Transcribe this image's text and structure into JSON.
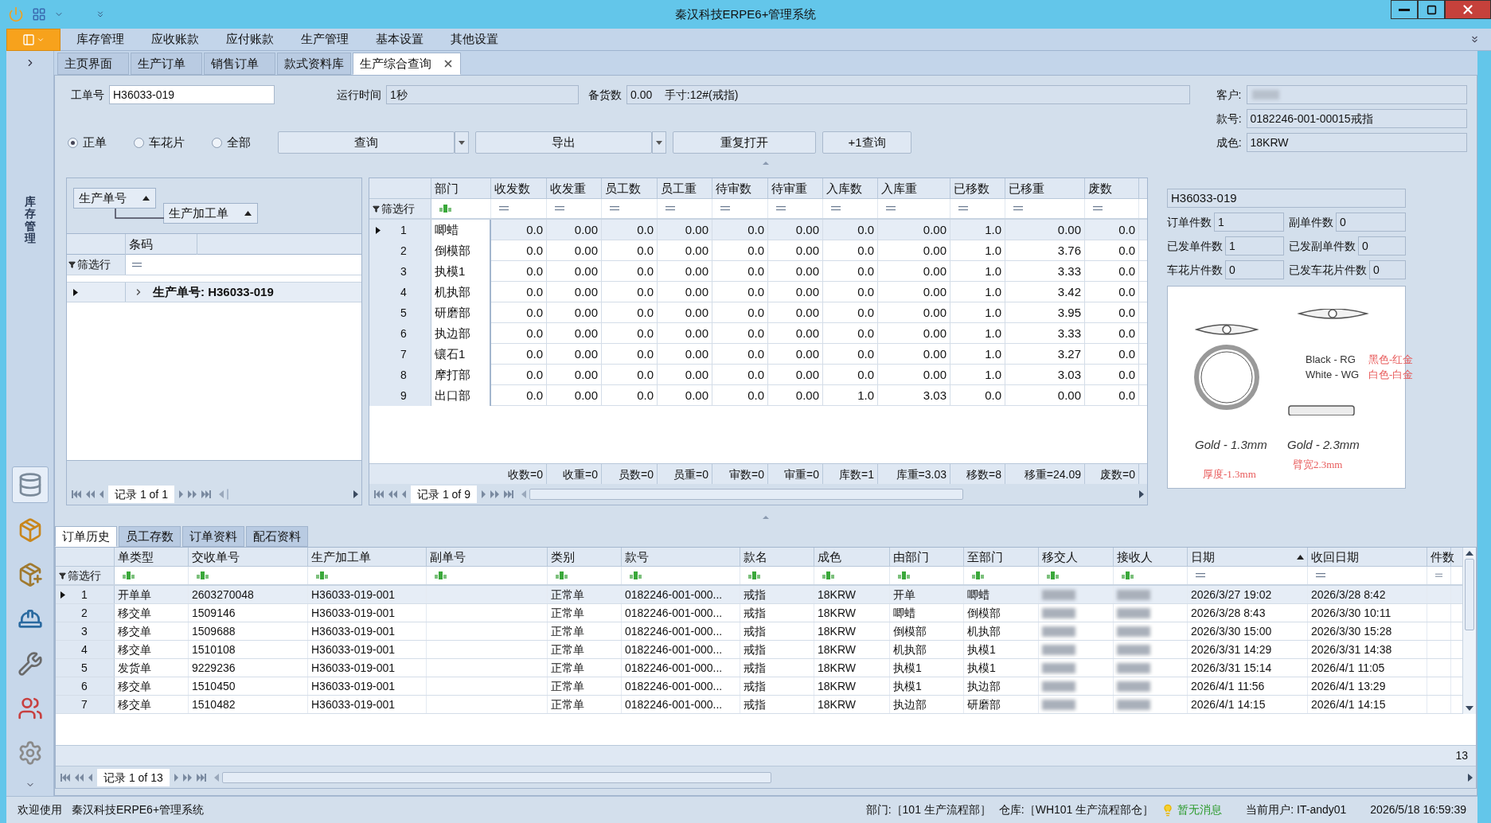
{
  "window": {
    "title": "秦汉科技ERPE6+管理系统"
  },
  "menu": [
    "库存管理",
    "应收账款",
    "应付账款",
    "生产管理",
    "基本设置",
    "其他设置"
  ],
  "sidebar": {
    "title": "库存管理"
  },
  "tabs": [
    {
      "label": "主页界面",
      "selected": false,
      "closable": false
    },
    {
      "label": "生产订单",
      "selected": false,
      "closable": false
    },
    {
      "label": "销售订单",
      "selected": false,
      "closable": false
    },
    {
      "label": "款式资料库",
      "selected": false,
      "closable": false
    },
    {
      "label": "生产综合查询",
      "selected": true,
      "closable": true
    }
  ],
  "form": {
    "work_order": {
      "label": "工单号",
      "value": "H36033-019"
    },
    "run_time": {
      "label": "运行时间",
      "value": "1秒"
    },
    "stock": {
      "label": "备货数",
      "value": "0.00    手寸:12#(戒指)"
    },
    "customer": {
      "label": "客户:",
      "masked": true
    },
    "style_no": {
      "label": "款号:",
      "value": "0182246-001-00015戒指"
    },
    "color": {
      "label": "成色:",
      "value": "18KRW"
    }
  },
  "radios": [
    {
      "label": "正单",
      "selected": true
    },
    {
      "label": "车花片",
      "selected": false
    },
    {
      "label": "全部",
      "selected": false
    }
  ],
  "buttons": [
    {
      "label": "查询",
      "dropdown": true
    },
    {
      "label": "导出",
      "dropdown": true
    },
    {
      "label": "重复打开",
      "dropdown": false
    },
    {
      "label": "+1查询",
      "dropdown": false
    }
  ],
  "group_panel": {
    "groups": [
      "生产单号",
      "生产加工单"
    ],
    "columns": [
      "条码"
    ],
    "filter_label": "筛选行",
    "group_row": "生产单号: H36033-019",
    "pager": "记录 1 of 1"
  },
  "dept_grid": {
    "columns": [
      {
        "label": "部门",
        "kind": "text"
      },
      {
        "label": "收发数",
        "kind": "number"
      },
      {
        "label": "收发重",
        "kind": "number"
      },
      {
        "label": "员工数",
        "kind": "number"
      },
      {
        "label": "员工重",
        "kind": "number"
      },
      {
        "label": "待审数",
        "kind": "number"
      },
      {
        "label": "待审重",
        "kind": "number"
      },
      {
        "label": "入库数",
        "kind": "number"
      },
      {
        "label": "入库重",
        "kind": "number"
      },
      {
        "label": "已移数",
        "kind": "number"
      },
      {
        "label": "已移重",
        "kind": "number"
      },
      {
        "label": "废数",
        "kind": "number"
      }
    ],
    "filter_label": "筛选行",
    "rows": [
      {
        "num": "1",
        "selected": true,
        "cells": [
          "唧蜡",
          "0.0",
          "0.00",
          "0.0",
          "0.00",
          "0.0",
          "0.00",
          "0.0",
          "0.00",
          "1.0",
          "0.00",
          "0.0"
        ]
      },
      {
        "num": "2",
        "selected": false,
        "cells": [
          "倒模部",
          "0.0",
          "0.00",
          "0.0",
          "0.00",
          "0.0",
          "0.00",
          "0.0",
          "0.00",
          "1.0",
          "3.76",
          "0.0"
        ]
      },
      {
        "num": "3",
        "selected": false,
        "cells": [
          "执模1",
          "0.0",
          "0.00",
          "0.0",
          "0.00",
          "0.0",
          "0.00",
          "0.0",
          "0.00",
          "1.0",
          "3.33",
          "0.0"
        ]
      },
      {
        "num": "4",
        "selected": false,
        "cells": [
          "机执部",
          "0.0",
          "0.00",
          "0.0",
          "0.00",
          "0.0",
          "0.00",
          "0.0",
          "0.00",
          "1.0",
          "3.42",
          "0.0"
        ]
      },
      {
        "num": "5",
        "selected": false,
        "cells": [
          "研磨部",
          "0.0",
          "0.00",
          "0.0",
          "0.00",
          "0.0",
          "0.00",
          "0.0",
          "0.00",
          "1.0",
          "3.95",
          "0.0"
        ]
      },
      {
        "num": "6",
        "selected": false,
        "cells": [
          "执边部",
          "0.0",
          "0.00",
          "0.0",
          "0.00",
          "0.0",
          "0.00",
          "0.0",
          "0.00",
          "1.0",
          "3.33",
          "0.0"
        ]
      },
      {
        "num": "7",
        "selected": false,
        "cells": [
          "镶石1",
          "0.0",
          "0.00",
          "0.0",
          "0.00",
          "0.0",
          "0.00",
          "0.0",
          "0.00",
          "1.0",
          "3.27",
          "0.0"
        ]
      },
      {
        "num": "8",
        "selected": false,
        "cells": [
          "摩打部",
          "0.0",
          "0.00",
          "0.0",
          "0.00",
          "0.0",
          "0.00",
          "0.0",
          "0.00",
          "1.0",
          "3.03",
          "0.0"
        ]
      },
      {
        "num": "9",
        "selected": false,
        "cells": [
          "出口部",
          "0.0",
          "0.00",
          "0.0",
          "0.00",
          "0.0",
          "0.00",
          "1.0",
          "3.03",
          "0.0",
          "0.00",
          "0.0"
        ]
      }
    ],
    "totals": [
      "收数=0",
      "收重=0",
      "员数=0",
      "员重=0",
      "审数=0",
      "审重=0",
      "库数=1",
      "库重=3.03",
      "移数=8",
      "移重=24.09",
      "废数=0"
    ],
    "pager": "记录 1 of 9"
  },
  "detail": {
    "header": "H36033-019",
    "fields": [
      {
        "label": "订单件数",
        "value": "1"
      },
      {
        "label": "副单件数",
        "value": "0"
      },
      {
        "label": "已发单件数",
        "value": "1"
      },
      {
        "label": "已发副单件数",
        "value": "0"
      },
      {
        "label": "车花片件数",
        "value": "0"
      },
      {
        "label": "已发车花片件数",
        "value": "0"
      }
    ],
    "image_labels": [
      {
        "text": "Black -  RG",
        "color": "#333333"
      },
      {
        "text": "White - WG",
        "color": "#333333"
      },
      {
        "text": "黑色-红金",
        "color": "#e85a5a"
      },
      {
        "text": "白色-白金",
        "color": "#e85a5a"
      },
      {
        "text": "Gold - 1.3mm",
        "color": "#333333"
      },
      {
        "text": "Gold - 2.3mm",
        "color": "#333333"
      },
      {
        "text": "厚度-1.3mm",
        "color": "#e85a5a"
      },
      {
        "text": "臂宽2.3mm",
        "color": "#e85a5a"
      }
    ]
  },
  "bottom_tabs": [
    {
      "label": "订单历史",
      "selected": true
    },
    {
      "label": "员工存数",
      "selected": false
    },
    {
      "label": "订单资料",
      "selected": false
    },
    {
      "label": "配石资料",
      "selected": false
    }
  ],
  "history_grid": {
    "columns": [
      {
        "label": "单类型",
        "kind": "text"
      },
      {
        "label": "交收单号",
        "kind": "text"
      },
      {
        "label": "生产加工单",
        "kind": "text"
      },
      {
        "label": "副单号",
        "kind": "text"
      },
      {
        "label": "类别",
        "kind": "text"
      },
      {
        "label": "款号",
        "kind": "text"
      },
      {
        "label": "款名",
        "kind": "text"
      },
      {
        "label": "成色",
        "kind": "text"
      },
      {
        "label": "由部门",
        "kind": "text"
      },
      {
        "label": "至部门",
        "kind": "text"
      },
      {
        "label": "移交人",
        "kind": "text",
        "masked": true
      },
      {
        "label": "接收人",
        "kind": "text",
        "masked": true
      },
      {
        "label": "日期",
        "kind": "number",
        "sorted": true
      },
      {
        "label": "收回日期",
        "kind": "number"
      },
      {
        "label": "件数",
        "kind": "number"
      }
    ],
    "filter_label": "筛选行",
    "rows": [
      {
        "num": "1",
        "selected": true,
        "cells": [
          "开单单",
          "2603270048",
          "H36033-019-001",
          "",
          "正常单",
          "0182246-001-000...",
          "戒指",
          "18KRW",
          "开单",
          "唧蜡",
          "",
          "",
          "2026/3/27 19:02",
          "2026/3/28 8:42",
          ""
        ]
      },
      {
        "num": "2",
        "selected": false,
        "cells": [
          "移交单",
          "1509146",
          "H36033-019-001",
          "",
          "正常单",
          "0182246-001-000...",
          "戒指",
          "18KRW",
          "唧蜡",
          "倒模部",
          "",
          "",
          "2026/3/28 8:43",
          "2026/3/30 10:11",
          ""
        ]
      },
      {
        "num": "3",
        "selected": false,
        "cells": [
          "移交单",
          "1509688",
          "H36033-019-001",
          "",
          "正常单",
          "0182246-001-000...",
          "戒指",
          "18KRW",
          "倒模部",
          "机执部",
          "",
          "",
          "2026/3/30 15:00",
          "2026/3/30 15:28",
          ""
        ]
      },
      {
        "num": "4",
        "selected": false,
        "cells": [
          "移交单",
          "1510108",
          "H36033-019-001",
          "",
          "正常单",
          "0182246-001-000...",
          "戒指",
          "18KRW",
          "机执部",
          "执模1",
          "",
          "",
          "2026/3/31 14:29",
          "2026/3/31 14:38",
          ""
        ]
      },
      {
        "num": "5",
        "selected": false,
        "cells": [
          "发货单",
          "9229236",
          "H36033-019-001",
          "",
          "正常单",
          "0182246-001-000...",
          "戒指",
          "18KRW",
          "执模1",
          "执模1",
          "",
          "",
          "2026/3/31 15:14",
          "2026/4/1 11:05",
          ""
        ]
      },
      {
        "num": "6",
        "selected": false,
        "cells": [
          "移交单",
          "1510450",
          "H36033-019-001",
          "",
          "正常单",
          "0182246-001-000...",
          "戒指",
          "18KRW",
          "执模1",
          "执边部",
          "",
          "",
          "2026/4/1 11:56",
          "2026/4/1 13:29",
          ""
        ]
      },
      {
        "num": "7",
        "selected": false,
        "cells": [
          "移交单",
          "1510482",
          "H36033-019-001",
          "",
          "正常单",
          "0182246-001-000...",
          "戒指",
          "18KRW",
          "执边部",
          "研磨部",
          "",
          "",
          "2026/4/1 14:15",
          "2026/4/1 14:15",
          ""
        ]
      }
    ],
    "count": "13",
    "pager": "记录 1 of 13"
  },
  "status_bar": {
    "welcome": "欢迎使用",
    "app": "秦汉科技ERPE6+管理系统",
    "dept": "部门:［101 生产流程部］",
    "warehouse": "仓库:［WH101 生产流程部仓］",
    "message": "暂无消息",
    "user": "当前用户: IT-andy01",
    "time": "2026/5/18 16:59:39"
  }
}
